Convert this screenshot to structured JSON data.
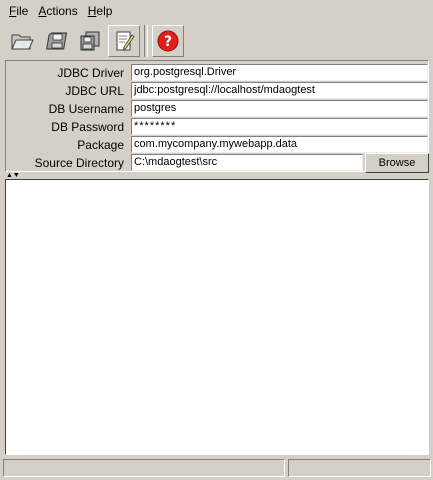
{
  "menu": {
    "file": {
      "mnemonic": "F",
      "rest": "ile"
    },
    "actions": {
      "mnemonic": "A",
      "rest": "ctions"
    },
    "help": {
      "mnemonic": "H",
      "rest": "elp"
    }
  },
  "toolbar": {
    "buttons": [
      "open-icon",
      "save-icon",
      "save-all-icon",
      "edit-icon",
      "help-icon"
    ],
    "help_color": "#e0201c"
  },
  "form": {
    "jdbc_driver": {
      "label": "JDBC Driver",
      "value": "org.postgresql.Driver"
    },
    "jdbc_url": {
      "label": "JDBC URL",
      "value": "jdbc:postgresql://localhost/mdaogtest"
    },
    "db_username": {
      "label": "DB Username",
      "value": "postgres"
    },
    "db_password": {
      "label": "DB Password",
      "value": "********"
    },
    "package": {
      "label": "Package",
      "value": "com.mycompany.mywebapp.data"
    },
    "source_directory": {
      "label": "Source Directory",
      "value": "C:\\mdaogtest\\src",
      "browse_label": "Browse"
    }
  },
  "output": {
    "text": ""
  },
  "status": {
    "left": "",
    "right": ""
  }
}
